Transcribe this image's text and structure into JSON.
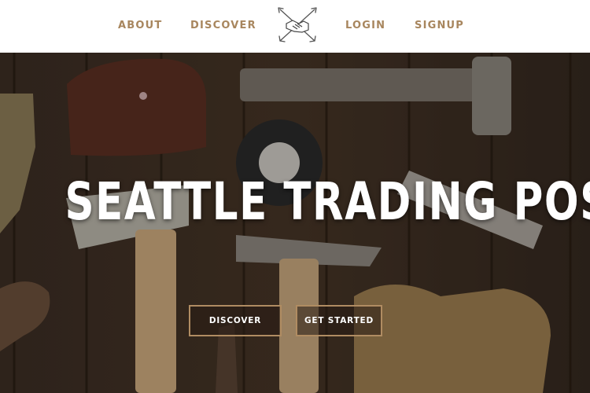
{
  "nav": {
    "about": "ABOUT",
    "discover": "DISCOVER",
    "login": "LOGIN",
    "signup": "SIGNUP",
    "logo_icon": "handshake-arrows-icon"
  },
  "hero": {
    "title": "SEATTLE TRADING POST",
    "discover_button": "DISCOVER",
    "get_started_button": "GET STARTED"
  },
  "colors": {
    "nav_text": "#a8865e",
    "button_border": "#b08c62",
    "hero_bg": "#3a2c22"
  }
}
